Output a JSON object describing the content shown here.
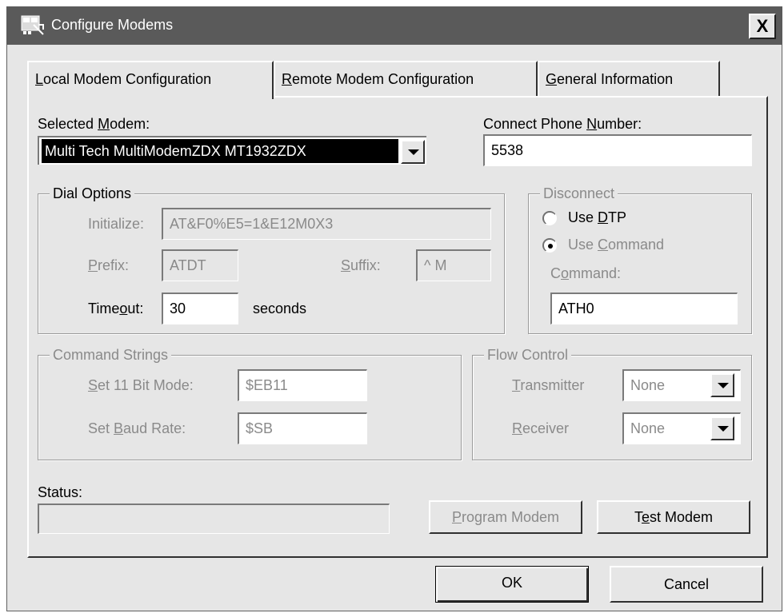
{
  "window": {
    "title": "Configure Modems",
    "close_label": "X"
  },
  "tabs": [
    {
      "pre": "",
      "u": "L",
      "post": "ocal Modem Configuration"
    },
    {
      "pre": "",
      "u": "R",
      "post": "emote Modem Configuration"
    },
    {
      "pre": "",
      "u": "G",
      "post": "eneral Information"
    }
  ],
  "modem": {
    "label_pre": "Selected ",
    "label_u": "M",
    "label_post": "odem:",
    "value": "Multi Tech MultiModemZDX MT1932ZDX"
  },
  "phone": {
    "label_pre": "Connect Phone ",
    "label_u": "N",
    "label_post": "umber:",
    "value": "5538"
  },
  "dial_options": {
    "legend": "Dial Options",
    "initialize_label": "Initialize:",
    "initialize_value": "AT&F0%E5=1&E12M0X3",
    "prefix_u": "P",
    "prefix_post": "refix:",
    "prefix_value": "ATDT",
    "suffix_u": "S",
    "suffix_post": "uffix:",
    "suffix_value": "^ M",
    "timeout_pre": "Time",
    "timeout_u": "o",
    "timeout_post": "ut:",
    "timeout_value": "30",
    "seconds_label": "seconds"
  },
  "disconnect": {
    "legend": "Disconnect",
    "use_dtp_pre": "Use ",
    "use_dtp_u": "D",
    "use_dtp_post": "TP",
    "use_cmd_pre": "Use ",
    "use_cmd_u": "C",
    "use_cmd_post": "ommand",
    "command_pre": "C",
    "command_u": "o",
    "command_post": "mmand:",
    "command_value": "ATH0"
  },
  "command_strings": {
    "legend": "Command Strings",
    "bit_u": "S",
    "bit_post": "et 11 Bit Mode:",
    "bit_value": "$EB11",
    "baud_pre": "Set ",
    "baud_u": "B",
    "baud_post": "aud Rate:",
    "baud_value": "$SB"
  },
  "flow_control": {
    "legend": "Flow Control",
    "tx_u": "T",
    "tx_post": "ransmitter",
    "tx_value": "None",
    "rx_u": "R",
    "rx_post": "eceiver",
    "rx_value": "None"
  },
  "status": {
    "label": "Status:",
    "value": ""
  },
  "buttons": {
    "program_u": "P",
    "program_post": "rogram Modem",
    "test_pre": "T",
    "test_u": "e",
    "test_post": "st Modem",
    "ok": "OK",
    "cancel": "Cancel"
  }
}
